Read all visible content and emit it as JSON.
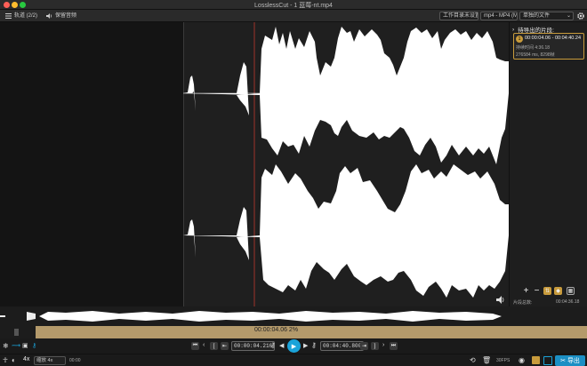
{
  "window": {
    "title": "LosslessCut - 1 蓝莓-nt.mp4"
  },
  "toolbar": {
    "tracks_label": "轨道 (2/2)",
    "keep_audio_label": "保留音频",
    "working_dir_label": "工作目录未设置",
    "format_select": "mp4 - MP4 (M…",
    "output_mode_select": "单独的文件"
  },
  "segments_panel": {
    "header": "待导出的片段:",
    "segment": {
      "number": "1",
      "time_range": "00:00:04.06 - 00:04:40.24",
      "duration_label": "持续时间 4:36.18",
      "detail": "276584 ms, 8298帧"
    },
    "total_label": "片段总数:",
    "total_value": "00:04:36.18"
  },
  "timeline": {
    "cursor_time": "00:00:04.06 2%"
  },
  "controls": {
    "start_time": "00:00:04.216",
    "end_time": "00:04:40.800"
  },
  "statusbar": {
    "speed": "4x",
    "zoom_select": "缩放 4x",
    "zoom_detail": "00:00",
    "export_label": "导出",
    "fps_label": "30FPS"
  },
  "colors": {
    "accent": "#1aa3d9",
    "timeline": "#b49a6b",
    "export_bg": "#1b8fc4"
  }
}
